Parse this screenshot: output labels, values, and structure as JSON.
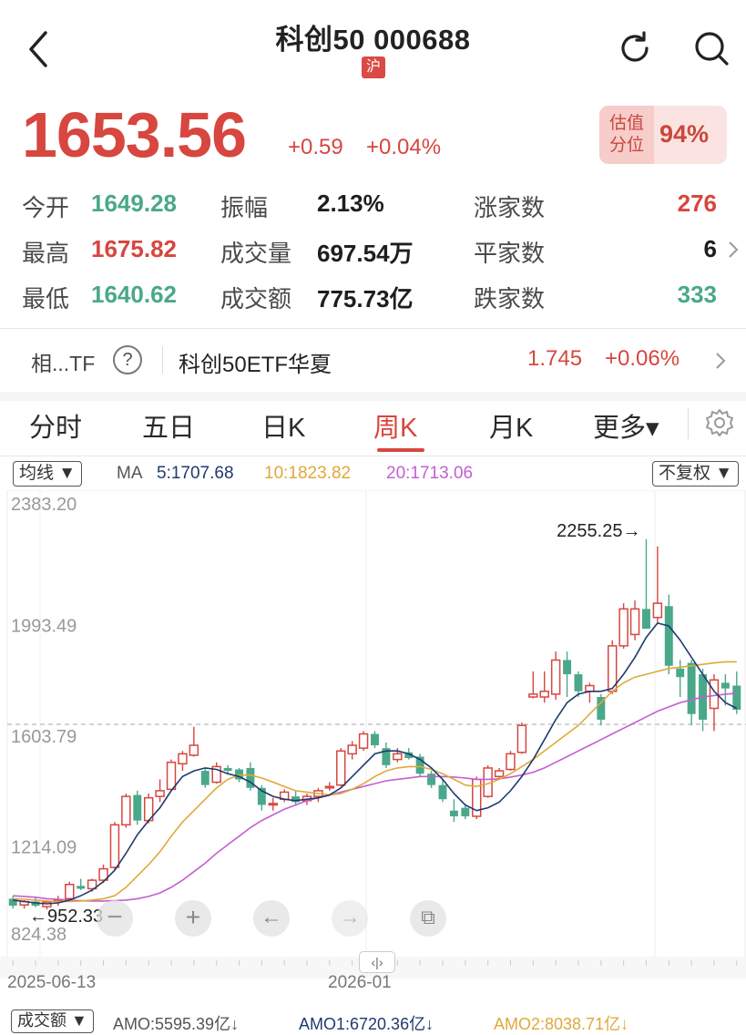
{
  "header": {
    "title": "科创50 000688",
    "exchange": "沪"
  },
  "quote": {
    "price": "1653.56",
    "change": "+0.59",
    "change_pct": "+0.04%",
    "valuation_label_1": "估值",
    "valuation_label_2": "分位",
    "valuation_value": "94%"
  },
  "stats": [
    [
      {
        "label": "今开",
        "value": "1649.28",
        "color": "green"
      },
      {
        "label": "振幅",
        "value": "2.13%",
        "color": "black"
      },
      {
        "label": "涨家数",
        "value": "276",
        "color": "red"
      }
    ],
    [
      {
        "label": "最高",
        "value": "1675.82",
        "color": "red"
      },
      {
        "label": "成交量",
        "value": "697.54万",
        "color": "black"
      },
      {
        "label": "平家数",
        "value": "6",
        "color": "black"
      }
    ],
    [
      {
        "label": "最低",
        "value": "1640.62",
        "color": "green"
      },
      {
        "label": "成交额",
        "value": "775.73亿",
        "color": "black"
      },
      {
        "label": "跌家数",
        "value": "333",
        "color": "green"
      }
    ]
  ],
  "etf": {
    "prefix": "相...TF",
    "help": "?",
    "name": "科创50ETF华夏",
    "price": "1.745",
    "pct": "+0.06%"
  },
  "tabs": [
    "分时",
    "五日",
    "日K",
    "周K",
    "月K",
    "更多▾"
  ],
  "active_tab": "周K",
  "indicator": {
    "selector": "均线 ▼",
    "ma": "MA",
    "ma5": "5:1707.68",
    "ma10": "10:1823.82",
    "ma20": "20:1713.06",
    "fq": "不复权 ▼"
  },
  "colors": {
    "up": "#d7463f",
    "down": "#4aa88a",
    "ma5": "#1f3a6e",
    "ma10": "#e0a83a",
    "ma20": "#c45fd0"
  },
  "controls": {
    "zoom_in": "+",
    "zoom_out": "−",
    "left": "←",
    "right": "→",
    "copy": "⧉"
  },
  "scroll_handle": "‹|›",
  "volume": {
    "selector": "成交额 ▼",
    "amo": "AMO:5595.39亿↓",
    "amo1": "AMO1:6720.36亿↓",
    "amo2": "AMO2:8038.71亿↓"
  },
  "chart_data": {
    "type": "candlestick",
    "y_labels": [
      "2383.20",
      "1993.49",
      "1603.79",
      "1214.09",
      "824.38"
    ],
    "ylim": [
      824.38,
      2383.2
    ],
    "x_labels": [
      "2025-06-13",
      "2026-01"
    ],
    "reference_price": "1603.79",
    "max_label": "2255.25→",
    "min_label": "←952.33",
    "candles": [
      {
        "o": 990,
        "h": 1000,
        "l": 955,
        "c": 965
      },
      {
        "o": 968,
        "h": 985,
        "l": 955,
        "c": 980
      },
      {
        "o": 980,
        "h": 995,
        "l": 960,
        "c": 965
      },
      {
        "o": 962,
        "h": 985,
        "l": 952,
        "c": 978
      },
      {
        "o": 980,
        "h": 1000,
        "l": 965,
        "c": 985
      },
      {
        "o": 990,
        "h": 1050,
        "l": 980,
        "c": 1040
      },
      {
        "o": 1035,
        "h": 1060,
        "l": 1020,
        "c": 1025
      },
      {
        "o": 1025,
        "h": 1060,
        "l": 1015,
        "c": 1055
      },
      {
        "o": 1055,
        "h": 1110,
        "l": 1045,
        "c": 1095
      },
      {
        "o": 1100,
        "h": 1260,
        "l": 1090,
        "c": 1250
      },
      {
        "o": 1250,
        "h": 1360,
        "l": 1240,
        "c": 1350
      },
      {
        "o": 1355,
        "h": 1370,
        "l": 1250,
        "c": 1265
      },
      {
        "o": 1265,
        "h": 1360,
        "l": 1255,
        "c": 1345
      },
      {
        "o": 1350,
        "h": 1410,
        "l": 1330,
        "c": 1370
      },
      {
        "o": 1375,
        "h": 1480,
        "l": 1370,
        "c": 1470
      },
      {
        "o": 1465,
        "h": 1510,
        "l": 1440,
        "c": 1500
      },
      {
        "o": 1495,
        "h": 1595,
        "l": 1490,
        "c": 1530
      },
      {
        "o": 1440,
        "h": 1450,
        "l": 1380,
        "c": 1390
      },
      {
        "o": 1400,
        "h": 1470,
        "l": 1395,
        "c": 1455
      },
      {
        "o": 1450,
        "h": 1460,
        "l": 1430,
        "c": 1440
      },
      {
        "o": 1445,
        "h": 1450,
        "l": 1400,
        "c": 1410
      },
      {
        "o": 1450,
        "h": 1470,
        "l": 1370,
        "c": 1380
      },
      {
        "o": 1380,
        "h": 1390,
        "l": 1300,
        "c": 1320
      },
      {
        "o": 1320,
        "h": 1345,
        "l": 1300,
        "c": 1325
      },
      {
        "o": 1340,
        "h": 1375,
        "l": 1330,
        "c": 1365
      },
      {
        "o": 1350,
        "h": 1370,
        "l": 1320,
        "c": 1330
      },
      {
        "o": 1335,
        "h": 1360,
        "l": 1320,
        "c": 1350
      },
      {
        "o": 1350,
        "h": 1380,
        "l": 1330,
        "c": 1370
      },
      {
        "o": 1380,
        "h": 1400,
        "l": 1370,
        "c": 1385
      },
      {
        "o": 1390,
        "h": 1520,
        "l": 1385,
        "c": 1510
      },
      {
        "o": 1500,
        "h": 1545,
        "l": 1480,
        "c": 1530
      },
      {
        "o": 1520,
        "h": 1580,
        "l": 1510,
        "c": 1570
      },
      {
        "o": 1570,
        "h": 1580,
        "l": 1520,
        "c": 1530
      },
      {
        "o": 1520,
        "h": 1540,
        "l": 1450,
        "c": 1460
      },
      {
        "o": 1480,
        "h": 1520,
        "l": 1470,
        "c": 1500
      },
      {
        "o": 1505,
        "h": 1520,
        "l": 1480,
        "c": 1485
      },
      {
        "o": 1490,
        "h": 1500,
        "l": 1420,
        "c": 1430
      },
      {
        "o": 1430,
        "h": 1440,
        "l": 1380,
        "c": 1390
      },
      {
        "o": 1390,
        "h": 1410,
        "l": 1330,
        "c": 1340
      },
      {
        "o": 1300,
        "h": 1340,
        "l": 1260,
        "c": 1280
      },
      {
        "o": 1310,
        "h": 1320,
        "l": 1270,
        "c": 1280
      },
      {
        "o": 1280,
        "h": 1420,
        "l": 1270,
        "c": 1410
      },
      {
        "o": 1350,
        "h": 1460,
        "l": 1345,
        "c": 1450
      },
      {
        "o": 1420,
        "h": 1450,
        "l": 1410,
        "c": 1440
      },
      {
        "o": 1445,
        "h": 1510,
        "l": 1440,
        "c": 1500
      },
      {
        "o": 1505,
        "h": 1610,
        "l": 1500,
        "c": 1600
      },
      {
        "o": 1700,
        "h": 1790,
        "l": 1695,
        "c": 1710
      },
      {
        "o": 1700,
        "h": 1790,
        "l": 1680,
        "c": 1720
      },
      {
        "o": 1710,
        "h": 1860,
        "l": 1690,
        "c": 1830
      },
      {
        "o": 1830,
        "h": 1860,
        "l": 1700,
        "c": 1780
      },
      {
        "o": 1780,
        "h": 1790,
        "l": 1700,
        "c": 1720
      },
      {
        "o": 1720,
        "h": 1750,
        "l": 1680,
        "c": 1740
      },
      {
        "o": 1700,
        "h": 1710,
        "l": 1600,
        "c": 1620
      },
      {
        "o": 1720,
        "h": 1900,
        "l": 1710,
        "c": 1880
      },
      {
        "o": 1880,
        "h": 2030,
        "l": 1870,
        "c": 2010
      },
      {
        "o": 1920,
        "h": 2040,
        "l": 1900,
        "c": 2010
      },
      {
        "o": 2010,
        "h": 2255.25,
        "l": 1990,
        "c": 1940
      },
      {
        "o": 1980,
        "h": 2230,
        "l": 1960,
        "c": 2030
      },
      {
        "o": 2020,
        "h": 2060,
        "l": 1780,
        "c": 1810
      },
      {
        "o": 1800,
        "h": 1830,
        "l": 1700,
        "c": 1770
      },
      {
        "o": 1820,
        "h": 1830,
        "l": 1600,
        "c": 1640
      },
      {
        "o": 1780,
        "h": 1800,
        "l": 1580,
        "c": 1620
      },
      {
        "o": 1660,
        "h": 1780,
        "l": 1580,
        "c": 1760
      },
      {
        "o": 1750,
        "h": 1780,
        "l": 1670,
        "c": 1730
      },
      {
        "o": 1740,
        "h": 1790,
        "l": 1640,
        "c": 1655
      }
    ],
    "ma5": [
      985,
      980,
      975,
      972,
      975,
      985,
      1000,
      1020,
      1050,
      1090,
      1150,
      1215,
      1265,
      1310,
      1370,
      1420,
      1440,
      1450,
      1445,
      1430,
      1420,
      1400,
      1370,
      1350,
      1340,
      1335,
      1340,
      1345,
      1355,
      1380,
      1420,
      1460,
      1500,
      1510,
      1510,
      1500,
      1480,
      1450,
      1410,
      1360,
      1320,
      1300,
      1310,
      1330,
      1370,
      1420,
      1480,
      1550,
      1620,
      1680,
      1710,
      1720,
      1720,
      1730,
      1780,
      1840,
      1910,
      1960,
      1950,
      1900,
      1840,
      1780,
      1720,
      1680,
      1660
    ],
    "ma10": [
      990,
      988,
      985,
      982,
      980,
      980,
      982,
      985,
      990,
      1000,
      1030,
      1070,
      1110,
      1155,
      1210,
      1260,
      1300,
      1340,
      1380,
      1410,
      1425,
      1425,
      1415,
      1400,
      1385,
      1370,
      1365,
      1360,
      1355,
      1360,
      1375,
      1395,
      1420,
      1440,
      1450,
      1455,
      1455,
      1445,
      1430,
      1410,
      1390,
      1385,
      1395,
      1410,
      1430,
      1455,
      1480,
      1510,
      1540,
      1570,
      1600,
      1640,
      1680,
      1720,
      1750,
      1770,
      1780,
      1790,
      1800,
      1805,
      1810,
      1815,
      1820,
      1823.82,
      1823.82
    ],
    "ma20": [
      1000,
      998,
      995,
      990,
      988,
      985,
      983,
      982,
      982,
      983,
      985,
      990,
      998,
      1010,
      1030,
      1055,
      1085,
      1115,
      1150,
      1180,
      1210,
      1240,
      1265,
      1285,
      1305,
      1320,
      1335,
      1345,
      1355,
      1365,
      1375,
      1385,
      1395,
      1405,
      1410,
      1415,
      1420,
      1420,
      1420,
      1418,
      1415,
      1410,
      1410,
      1412,
      1418,
      1425,
      1435,
      1450,
      1470,
      1490,
      1510,
      1530,
      1550,
      1570,
      1590,
      1610,
      1630,
      1650,
      1665,
      1680,
      1690,
      1700,
      1705,
      1710,
      1713.06
    ]
  }
}
